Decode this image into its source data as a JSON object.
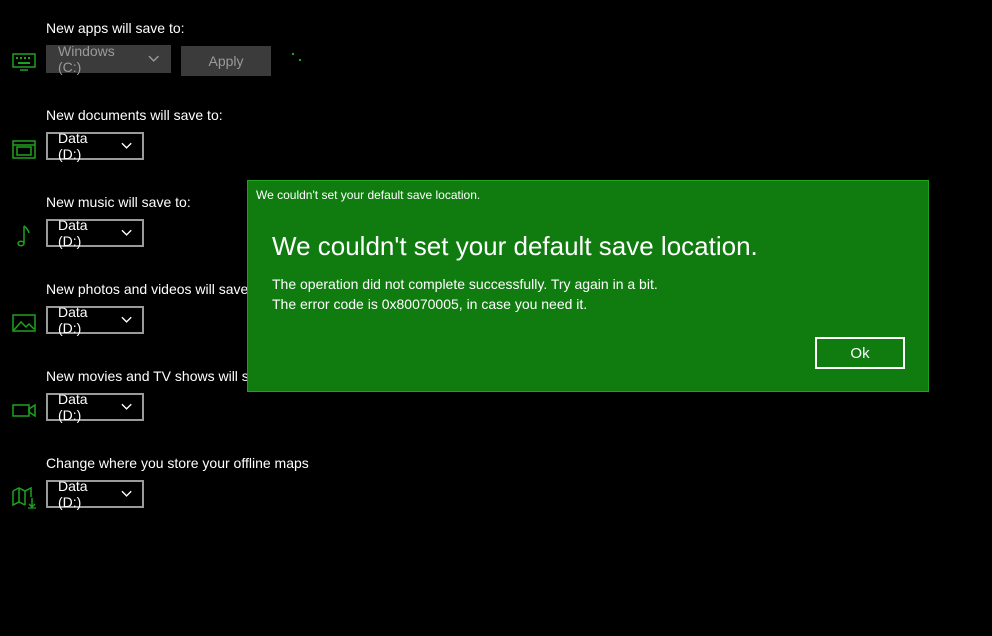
{
  "settings": {
    "apps": {
      "label": "New apps will save to:",
      "value": "Windows (C:)",
      "apply_label": "Apply"
    },
    "documents": {
      "label": "New documents will save to:",
      "value": "Data (D:)"
    },
    "music": {
      "label": "New music will save to:",
      "value": "Data (D:)"
    },
    "photos": {
      "label": "New photos and videos will save to:",
      "value": "Data (D:)"
    },
    "movies": {
      "label": "New movies and TV shows will save to:",
      "value": "Data (D:)"
    },
    "maps": {
      "label": "Change where you store your offline maps",
      "value": "Data (D:)"
    }
  },
  "dialog": {
    "caption": "We couldn't set your default save location.",
    "title": "We couldn't set your default save location.",
    "message_line1": "The operation did not complete successfully. Try again in a bit.",
    "message_line2": "The error code is 0x80070005, in case you need it.",
    "ok_label": "Ok"
  },
  "icons": {
    "apps": "keyboard-icon",
    "documents": "document-drive-icon",
    "music": "music-note-icon",
    "photos": "photo-icon",
    "movies": "video-camera-icon",
    "maps": "map-download-icon"
  },
  "colors": {
    "accent": "#107c10",
    "icon": "#1fa31f",
    "background": "#000000",
    "disabled": "#3b3b3b"
  }
}
